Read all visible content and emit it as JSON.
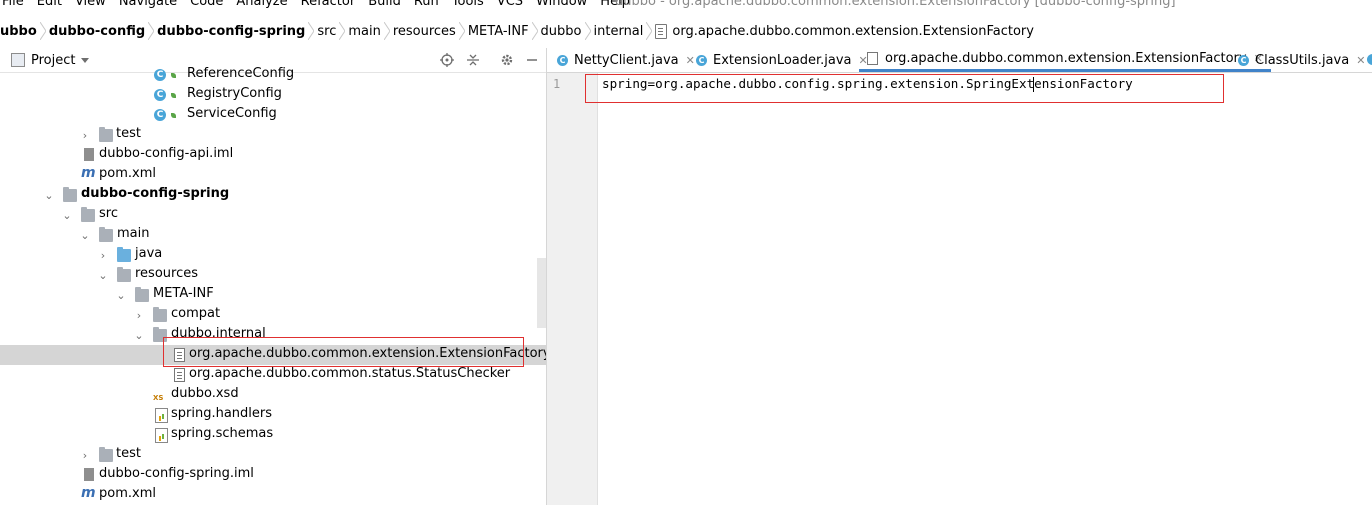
{
  "menubar": {
    "items": [
      "File",
      "Edit",
      "View",
      "Navigate",
      "Code",
      "Analyze",
      "Refactor",
      "Build",
      "Run",
      "Tools",
      "VCS",
      "Window",
      "Help"
    ],
    "window_title": "dubbo - org.apache.dubbo.common.extension.ExtensionFactory [dubbo-config-spring]"
  },
  "breadcrumb": [
    "ubbo",
    "dubbo-config",
    "dubbo-config-spring",
    "src",
    "main",
    "resources",
    "META-INF",
    "dubbo",
    "internal",
    "org.apache.dubbo.common.extension.ExtensionFactory"
  ],
  "project_panel": {
    "title": "Project",
    "tree": [
      {
        "label": "ReferenceConfig"
      },
      {
        "label": "RegistryConfig"
      },
      {
        "label": "ServiceConfig"
      },
      {
        "label": "test"
      },
      {
        "label": "dubbo-config-api.iml"
      },
      {
        "label": "pom.xml"
      },
      {
        "label": "dubbo-config-spring"
      },
      {
        "label": "src"
      },
      {
        "label": "main"
      },
      {
        "label": "java"
      },
      {
        "label": "resources"
      },
      {
        "label": "META-INF"
      },
      {
        "label": "compat"
      },
      {
        "label": "dubbo.internal"
      },
      {
        "label": "org.apache.dubbo.common.extension.ExtensionFactory"
      },
      {
        "label": "org.apache.dubbo.common.status.StatusChecker"
      },
      {
        "label": "dubbo.xsd"
      },
      {
        "label": "spring.handlers"
      },
      {
        "label": "spring.schemas"
      },
      {
        "label": "test"
      },
      {
        "label": "dubbo-config-spring.iml"
      },
      {
        "label": "pom.xml"
      }
    ]
  },
  "tabs": [
    {
      "label": "NettyClient.java"
    },
    {
      "label": "ExtensionLoader.java"
    },
    {
      "label": "org.apache.dubbo.common.extension.ExtensionFactory"
    },
    {
      "label": "ClassUtils.java"
    }
  ],
  "editor": {
    "line_number": "1",
    "code": "spring=org.apache.dubbo.config.spring.extension.SpringExtensionFactory"
  },
  "colors": {
    "highlight_box": "#e03030",
    "active_tab": "#4083c9",
    "selected_row": "#d5d5d5"
  }
}
